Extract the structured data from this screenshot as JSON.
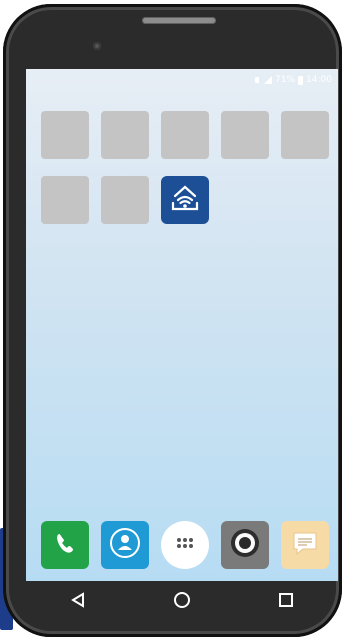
{
  "statusbar": {
    "battery_text": "71%",
    "time": "14:00"
  },
  "home": {
    "row1_apps": [
      "app",
      "app",
      "app",
      "app",
      "app"
    ],
    "row2_apps": [
      "app",
      "app"
    ],
    "highlighted_app_icon": "wifi-connect-icon"
  },
  "dock": {
    "apps": [
      {
        "icon": "phone-icon"
      },
      {
        "icon": "contacts-icon"
      },
      {
        "icon": "app-drawer-icon"
      },
      {
        "icon": "camera-icon"
      },
      {
        "icon": "messages-icon"
      }
    ]
  },
  "navigation": {
    "back_icon": "back-triangle-icon",
    "home_icon": "home-circle-icon",
    "recents_icon": "recents-square-icon"
  },
  "colors": {
    "accent": "#1d4f97",
    "phone_green": "#23a348",
    "contacts_blue": "#1f9ad4",
    "message_cream": "#f7dba6"
  }
}
